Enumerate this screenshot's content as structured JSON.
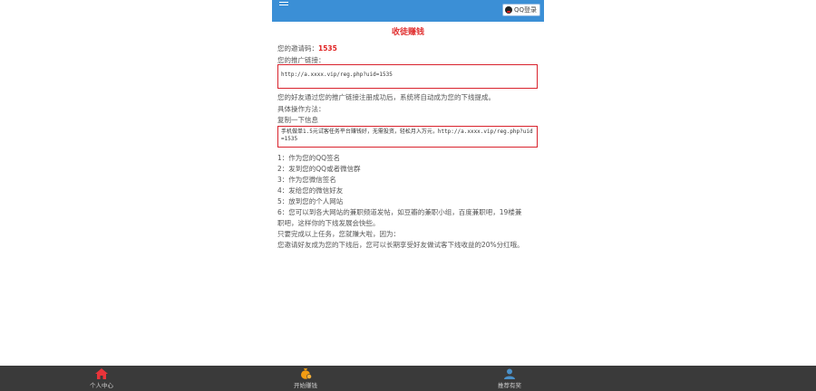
{
  "header": {
    "qq_button_label": "QQ登录"
  },
  "page": {
    "title": "收徒赚钱"
  },
  "invite": {
    "code_label": "您的邀请码：",
    "code_value": "1535",
    "link_label": "您的推广链接：",
    "link_value": "http://a.xxxx.vip/reg.php?uid=1535",
    "note": "您的好友通过您的推广链接注册成功后，系统将自动成为您的下线提成。",
    "howto_label": "具体操作方法：",
    "copy_label": "复制一下信息",
    "share_text": "手机做单1.5元试客任务平台赚钱好，无需投资，轻松月入万元，http://a.xxxx.vip/reg.php?uid=1535"
  },
  "steps": [
    "1：作为您的QQ签名",
    "2：发到您的QQ或者微信群",
    "3：作为您微信签名",
    "4：发给您的微信好友",
    "5：放到您的个人网站",
    "6：您可以到各大网站的兼职频道发帖，如豆瓣的兼职小组，百度兼职吧，19楼兼",
    "职吧，这样你的下线发展会快些。"
  ],
  "footer_text": {
    "line1": "只要完成以上任务，您就赚大啦，因为：",
    "line2": "您邀请好友成为您的下线后，您可以长期享受好友做试客下线收益的20%分红哦。"
  },
  "bottom_nav": [
    {
      "label": "个人中心",
      "icon": "home-icon",
      "color": "#e8343a"
    },
    {
      "label": "开始赚钱",
      "icon": "money-bag-icon",
      "color": "#f39c12"
    },
    {
      "label": "推荐有奖",
      "icon": "users-icon",
      "color": "#4a90c8"
    }
  ]
}
